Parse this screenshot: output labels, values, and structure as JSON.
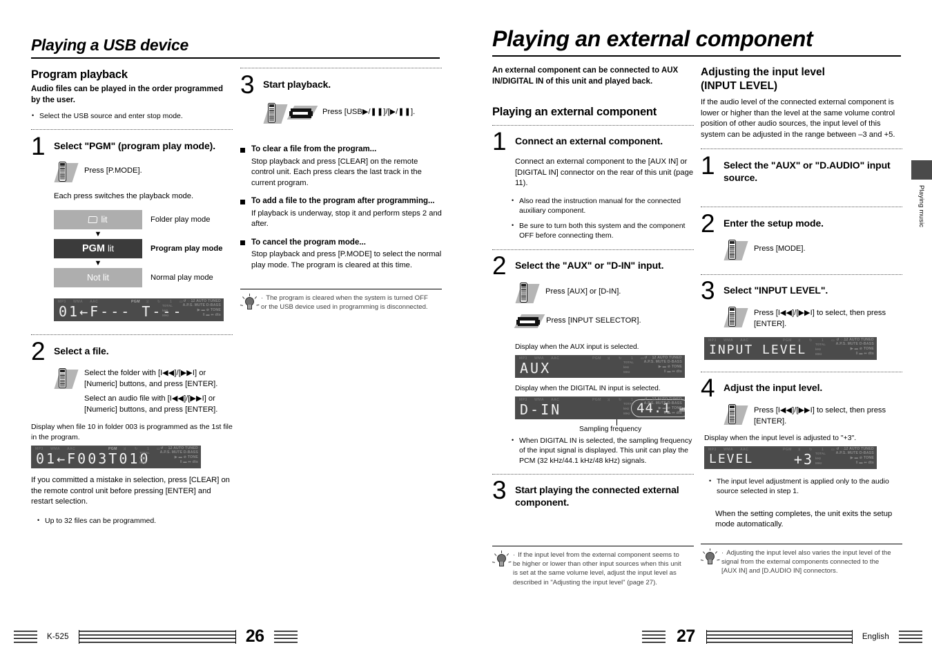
{
  "left_page": {
    "chapter_title": "Playing a USB device",
    "section_title": "Program playback",
    "intro": "Audio files can be played in the order programmed by the user.",
    "intro_bullet": "Select the USB source and enter stop mode.",
    "step1": {
      "num": "1",
      "title": "Select \"PGM\" (program play mode).",
      "press": "Press [P.MODE].",
      "note": "Each press switches the playback mode.",
      "modes": [
        {
          "box": "lit",
          "label": "Folder play mode",
          "style": "light",
          "icon": "folder-icon"
        },
        {
          "box_strong": "PGM",
          "box": "lit",
          "label": "Program play mode",
          "style": "dark"
        },
        {
          "box": "Not lit",
          "label": "Normal play mode",
          "style": "light"
        }
      ],
      "arrow": "▼",
      "lcd": {
        "main": "01←F--- T---",
        "top_indicators": [
          "MP3",
          "WMA",
          "AAC",
          "PGM",
          "⤨",
          "↻",
          "1",
          "□",
          "♪"
        ],
        "right_rows": [
          "↺ ⊙ 12 AUTO TUNED",
          "A.P.S. MUTE D-BASS",
          "▶ ▬ ⊘ TONE",
          "Ⅱ ▬ ↭ dts"
        ],
        "right_left_labels": [
          "TOTAL",
          "kHz",
          "MHz"
        ]
      }
    },
    "step2": {
      "num": "2",
      "title": "Select a file.",
      "instr1": "Select the folder with [I◀◀]/[▶▶I] or [Numeric] buttons, and press [ENTER].",
      "instr2": "Select an audio file with [I◀◀]/[▶▶I] or [Numeric] buttons, and press [ENTER].",
      "display_caption": "Display when file 10 in folder 003 is programmed as the 1st file in the program.",
      "lcd": {
        "main": "01←F003T010"
      },
      "after": "If you committed a mistake in selection, press [CLEAR] on the remote control unit before pressing [ENTER] and restart selection.",
      "bullet": "Up to 32 files can be programmed."
    },
    "step3": {
      "num": "3",
      "title": "Start playback.",
      "press": "Press [USB▶/❚❚]/[▶/❚❚].",
      "notes": [
        {
          "heading": "To clear a file from the program...",
          "text": "Stop playback and press [CLEAR] on the remote control unit. Each press clears the last track in the current program."
        },
        {
          "heading": "To add a file to the program after programming...",
          "text": "If playback is underway, stop it and perform steps 2 and after."
        },
        {
          "heading": "To cancel the program mode...",
          "text": "Stop playback and press [P.MODE] to select the normal play mode. The program is cleared at this time."
        }
      ]
    },
    "tip": "The program is cleared when the system is turned OFF or the USB device used in programming is disconnected.",
    "footer": {
      "model": "K-525",
      "page": "26"
    }
  },
  "right_page": {
    "chapter_title": "Playing an external component",
    "intro": "An external component can be connected to AUX IN/DIGITAL IN of this unit and played back.",
    "section_title": "Playing an external component",
    "step1": {
      "num": "1",
      "title": "Connect an external component.",
      "text": "Connect an external component to the [AUX IN] or [DIGITAL IN] connector on the rear of this unit (page 11).",
      "bullets": [
        "Also read the instruction manual for the connected auxiliary component.",
        "Be sure to turn both this system and the component OFF before connecting them."
      ]
    },
    "step2": {
      "num": "2",
      "title": "Select the \"AUX\" or \"D-IN\" input.",
      "press_remote": "Press [AUX] or [D-IN].",
      "press_unit": "Press [INPUT SELECTOR].",
      "caption_aux": "Display when the AUX input is selected.",
      "lcd_aux": {
        "main": "AUX"
      },
      "caption_din": "Display when the DIGITAL IN input is selected.",
      "lcd_din": {
        "main": "D-IN",
        "freq": "44.1",
        "unit": "kHz"
      },
      "callout": "Sampling frequency",
      "bullet": "When DIGITAL IN is selected, the sampling frequency of the input signal is displayed. This unit can play the PCM (32 kHz/44.1 kHz/48 kHz) signals."
    },
    "step3": {
      "num": "3",
      "title": "Start playing the connected external component."
    },
    "tip": "If the input level from the external component seems to be higher or lower than other input sources when this unit is set at the same volume level, adjust the input level as described in \"Adjusting the input level\" (page 27).",
    "side_tab": "Playing music",
    "footer": {
      "page": "27",
      "language": "English"
    }
  },
  "right_column": {
    "section_title_line1": "Adjusting the input level",
    "section_title_line2": "(INPUT LEVEL)",
    "intro": "If the audio level of the connected external component is lower or higher than the level at the same volume control position of other audio sources, the input level of this system can be adjusted in the range between –3 and +5.",
    "step1": {
      "num": "1",
      "title": "Select the \"AUX\" or \"D.AUDIO\" input source."
    },
    "step2": {
      "num": "2",
      "title": "Enter the setup mode.",
      "press": "Press [MODE]."
    },
    "step3": {
      "num": "3",
      "title": "Select \"INPUT LEVEL\".",
      "press": "Press [I◀◀]/[▶▶I] to select, then press [ENTER].",
      "lcd": {
        "main": "INPUT LEVEL"
      }
    },
    "step4": {
      "num": "4",
      "title": "Adjust the input level.",
      "press": "Press [I◀◀]/[▶▶I] to select, then press [ENTER].",
      "display_caption": "Display when the input level is adjusted to \"+3\".",
      "lcd": {
        "main": "LEVEL",
        "value": "+3"
      },
      "bullet": "The input level adjustment is applied only to the audio source selected in step 1.",
      "after": "When the setting completes, the unit exits the setup mode automatically."
    },
    "tip": "Adjusting the input level also varies the input level of the signal from the external components connected to the [AUX IN] and [D.AUDIO IN] connectors."
  },
  "lcd_common": {
    "top_left": [
      "MP3",
      "WMA",
      "AAC"
    ],
    "top_mid": [
      "PGM",
      "⤨",
      "↻",
      "1",
      "▭",
      "♪"
    ],
    "right_r1": "↺ ◌ 12 AUTO TUNED",
    "right_r2": "A.P.S. MUTE D-BASS",
    "right_r3": "▶ ▬ ⊘ TONE",
    "right_r4": "‖ ▬ ↭ dts",
    "right_col_labels": [
      "TOTAL",
      "kHz",
      "MHz"
    ]
  }
}
